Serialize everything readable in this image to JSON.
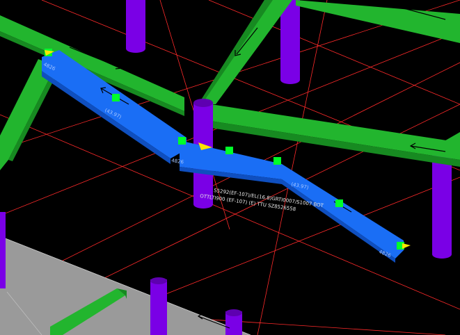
{
  "colors": {
    "background": "#000000",
    "grid": "#ff2a2a",
    "beam_green": "#22b52e",
    "beam_green_dark": "#178a21",
    "column_purple": "#7a00e6",
    "column_purple_dark": "#5e00b0",
    "beam_blue": "#1a6ef5",
    "beam_blue_dark": "#0f4fbf",
    "grip_green": "#00ff2a",
    "marker_yellow": "#ffe600",
    "slab_gray": "#9a9a9a",
    "text_light": "#a7c7ff",
    "text_white": "#e8e8e8"
  },
  "icons": {
    "grip": "grip-square-icon",
    "direction_marker": "direction-triangle-icon",
    "direction_arrow": "direction-arrow-icon"
  },
  "labels": {
    "segment_start": "4826",
    "segment_1": "(43.97)",
    "segment_mid": "4826",
    "segment_2": "(43.97)",
    "segment_end": "4826",
    "annotation_line_1": "S5292(EF-107)/EL(16.8)GRTI0007/S1007 BOT",
    "annotation_line_2": "OTTLTI900 (EF-107)   (E)  TTU SZ8526558"
  }
}
